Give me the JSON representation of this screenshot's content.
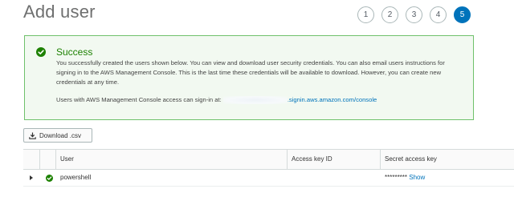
{
  "page": {
    "title": "Add user"
  },
  "wizard": {
    "steps": [
      "1",
      "2",
      "3",
      "4",
      "5"
    ],
    "active_step": "5"
  },
  "alert": {
    "title": "Success",
    "body": "You successfully created the users shown below. You can view and download user security credentials. You can also email users instructions for signing in to the AWS Management Console. This is the last time these credentials will be available to download. However, you can create new credentials at any time.",
    "signin_label": "Users with AWS Management Console access can sign-in at:",
    "signin_link": ".signin.aws.amazon.com/console",
    "colors": {
      "border": "#6fc16b",
      "background": "#f2f9f1",
      "success": "#1d8102"
    }
  },
  "toolbar": {
    "download_label": "Download .csv"
  },
  "table": {
    "columns": [
      "User",
      "Access key ID",
      "Secret access key"
    ],
    "rows": [
      {
        "user": "powershell",
        "access_key_id": "",
        "secret_masked": "*********",
        "show_label": "Show"
      }
    ]
  },
  "icons": {
    "success": "check-circle-icon",
    "download": "download-icon",
    "expand": "caret-right-icon"
  },
  "colors": {
    "link": "#0073bb",
    "active_step": "#0073bb"
  }
}
